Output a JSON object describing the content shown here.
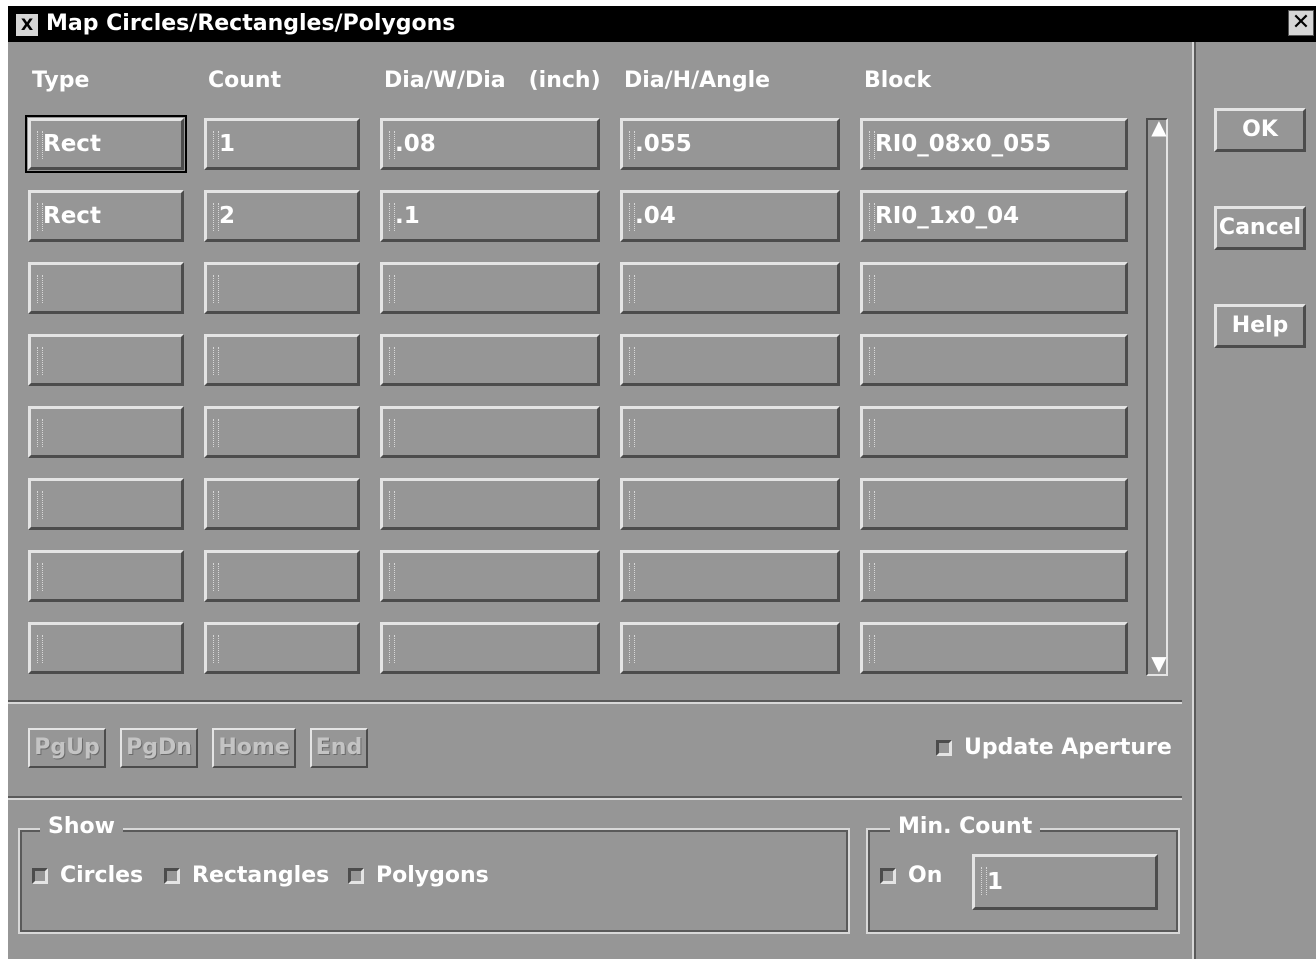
{
  "window": {
    "title": "Map Circles/Rectangles/Polygons",
    "menu_glyph": "X",
    "close_glyph": "✕"
  },
  "columns": [
    "Type",
    "Count",
    "Dia/W/Dia   (inch)",
    "Dia/H/Angle",
    "Block"
  ],
  "rows": [
    [
      "Rect",
      "1",
      ".08",
      ".055",
      "RI0_08x0_055"
    ],
    [
      "Rect",
      "2",
      ".1",
      ".04",
      "RI0_1x0_04"
    ],
    [
      "",
      "",
      "",
      "",
      ""
    ],
    [
      "",
      "",
      "",
      "",
      ""
    ],
    [
      "",
      "",
      "",
      "",
      ""
    ],
    [
      "",
      "",
      "",
      "",
      ""
    ],
    [
      "",
      "",
      "",
      "",
      ""
    ],
    [
      "",
      "",
      "",
      "",
      ""
    ]
  ],
  "scroll": {
    "up_glyph": "▲",
    "down_glyph": "▼"
  },
  "nav": {
    "pgup": "PgUp",
    "pgdn": "PgDn",
    "home": "Home",
    "end": "End"
  },
  "update_aperture": {
    "label": "Update Aperture",
    "checked": false
  },
  "show": {
    "legend": "Show",
    "circles": "Circles",
    "rectangles": "Rectangles",
    "polygons": "Polygons"
  },
  "min_count": {
    "legend": "Min. Count",
    "on_label": "On",
    "value": "1"
  },
  "buttons": {
    "ok": "OK",
    "cancel": "Cancel",
    "help": "Help"
  }
}
